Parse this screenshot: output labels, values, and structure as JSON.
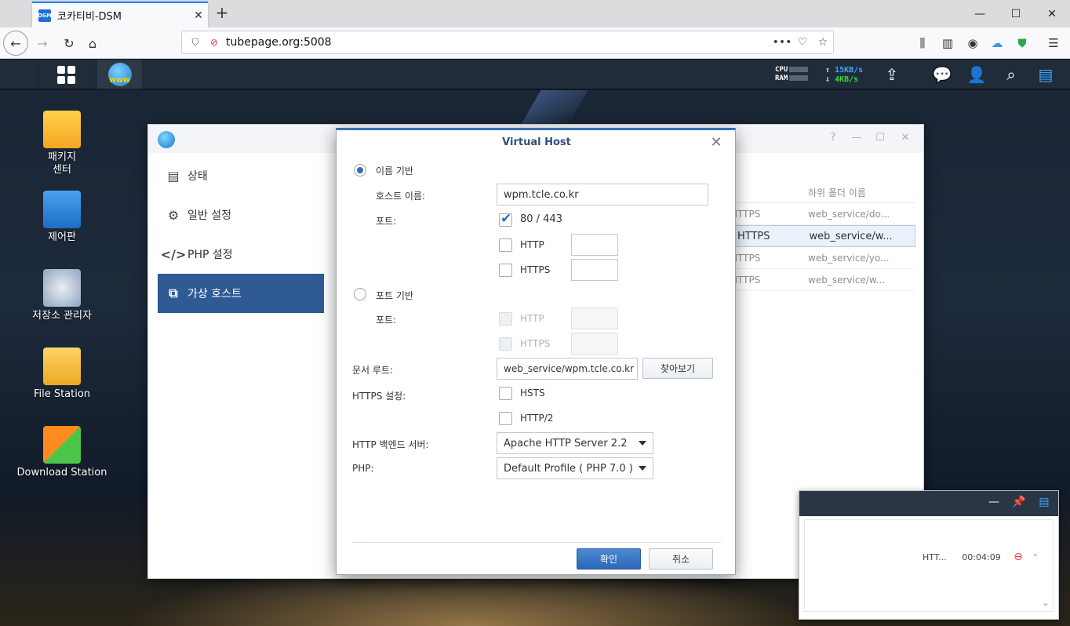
{
  "browser": {
    "tab_title": "코카티비-DSM",
    "favicon_text": "DSM",
    "url": "tubepage.org:5008",
    "menu_dots": "•••"
  },
  "taskbar": {
    "cpu_label": "CPU",
    "ram_label": "RAM",
    "upload_speed": "15KB/s",
    "download_speed": "4KB/s",
    "app_icon_text": "WWW"
  },
  "desktop_icons": [
    {
      "label": "패키지\n센터"
    },
    {
      "label": "제어판"
    },
    {
      "label": "저장소 관리자"
    },
    {
      "label": "File Station"
    },
    {
      "label": "Download Station"
    }
  ],
  "window": {
    "sidebar": [
      {
        "label": "상태"
      },
      {
        "label": "일반 설정"
      },
      {
        "label": "PHP 설정"
      },
      {
        "label": "가상 호스트"
      }
    ],
    "table": {
      "header_subfolder": "하위 폴더 이름",
      "rows": [
        {
          "c1": "HTTPS",
          "c2": "web_service/do..."
        },
        {
          "c1": "HTTPS",
          "c2": "web_service/w..."
        },
        {
          "c1": "HTTPS",
          "c2": "web_service/yo..."
        },
        {
          "c1": "HTTPS",
          "c2": "web_service/w..."
        }
      ]
    }
  },
  "task_panel": {
    "task_name": "HTT...",
    "task_time": "00:04:09"
  },
  "modal": {
    "title": "Virtual Host",
    "name_based_label": "이름 기반",
    "host_name_label": "호스트 이름:",
    "host_name_value": "wpm.tcle.co.kr",
    "port_label": "포트:",
    "port_default_label": "80 / 443",
    "http_label": "HTTP",
    "https_label": "HTTPS",
    "port_based_label": "포트 기반",
    "port_label2": "포트:",
    "http_label2": "HTTP",
    "https_label2": "HTTPS",
    "doc_root_label": "문서 루트:",
    "doc_root_value": "web_service/wpm.tcle.co.kr",
    "browse_label": "찾아보기",
    "https_settings_label": "HTTPS 설정:",
    "hsts_label": "HSTS",
    "http2_label": "HTTP/2",
    "backend_label": "HTTP 백엔드 서버:",
    "backend_value": "Apache HTTP Server 2.2",
    "php_label": "PHP:",
    "php_value": "Default Profile ( PHP 7.0 )",
    "ok_label": "확인",
    "cancel_label": "취소"
  }
}
